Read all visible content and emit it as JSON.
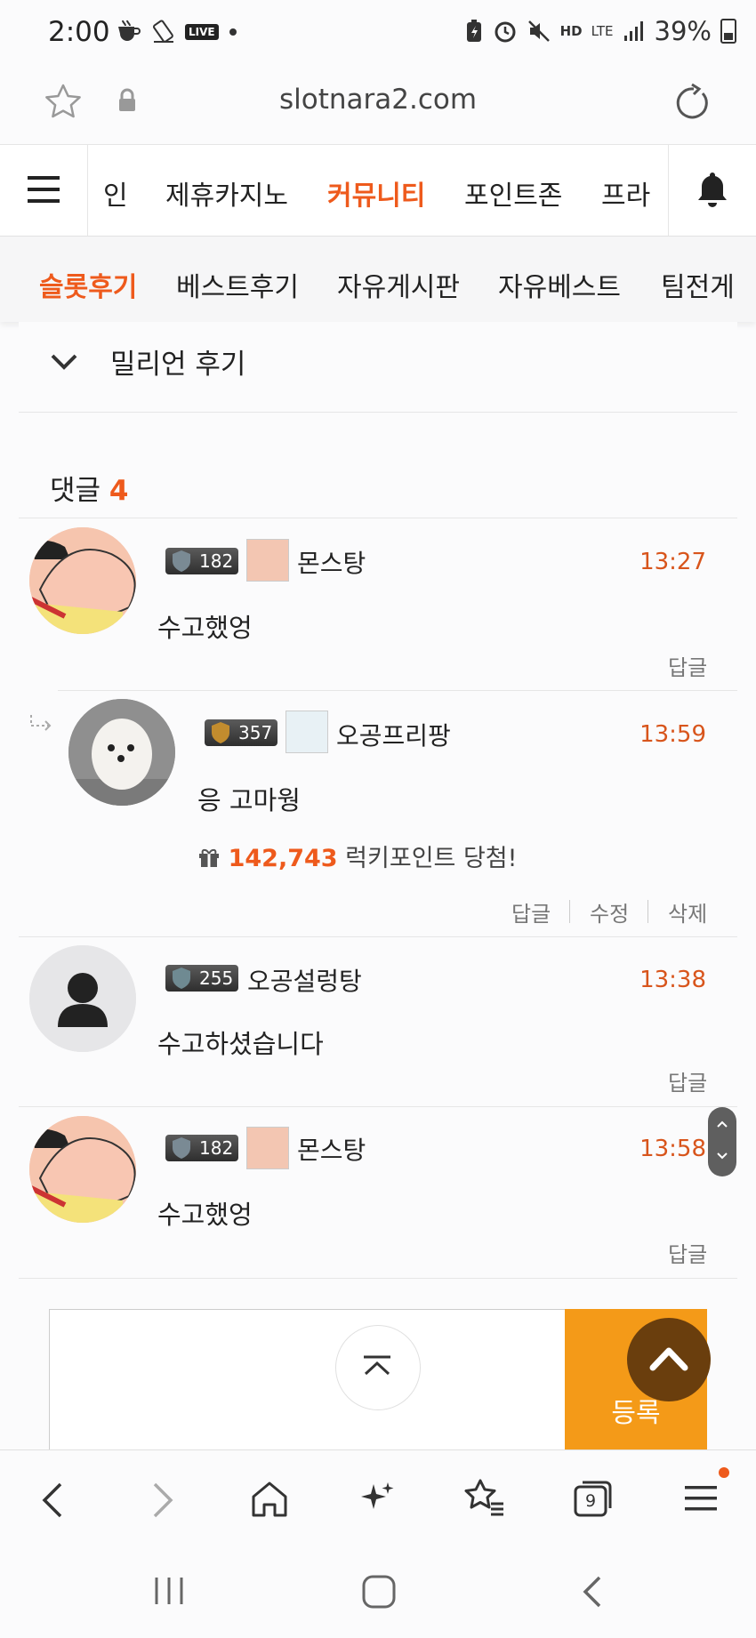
{
  "status_bar": {
    "time": "2:00",
    "live_badge": "LIVE",
    "hd_label": "HD",
    "lte_label": "LTE",
    "battery": "39%"
  },
  "browser": {
    "url": "slotnara2.com",
    "tab_count": "9"
  },
  "main_nav": {
    "items": [
      {
        "label": "인"
      },
      {
        "label": "제휴카지노"
      },
      {
        "label": "커뮤니티",
        "active": true
      },
      {
        "label": "포인트존"
      },
      {
        "label": "프라"
      }
    ]
  },
  "sub_nav": {
    "items": [
      {
        "label": "슬롯후기",
        "active": true
      },
      {
        "label": "베스트후기"
      },
      {
        "label": "자유게시판"
      },
      {
        "label": "자유베스트"
      },
      {
        "label": "팀전게"
      }
    ]
  },
  "category": {
    "label": "밀리언 후기"
  },
  "comments_header": {
    "label": "댓글",
    "count": "4"
  },
  "comments": [
    {
      "level": "182",
      "nickname": "몬스탕",
      "time": "13:27",
      "text": "수고했엉",
      "reply": "답글"
    },
    {
      "level": "357",
      "nickname": "오공프리팡",
      "time": "13:59",
      "text": "응 고마웡",
      "lucky_points": "142,743",
      "lucky_text": "럭키포인트 당첨!",
      "reply": "답글",
      "edit": "수정",
      "delete": "삭제"
    },
    {
      "level": "255",
      "nickname": "오공설렁탕",
      "time": "13:38",
      "text": "수고하셨습니다",
      "reply": "답글"
    },
    {
      "level": "182",
      "nickname": "몬스탕",
      "time": "13:58",
      "text": "수고했엉",
      "reply": "답글"
    }
  ],
  "comment_form": {
    "submit_label": "등록"
  },
  "colors": {
    "accent": "#ee5a1c",
    "submit": "#f49a18",
    "scroll_top": "#6a3e0d"
  }
}
